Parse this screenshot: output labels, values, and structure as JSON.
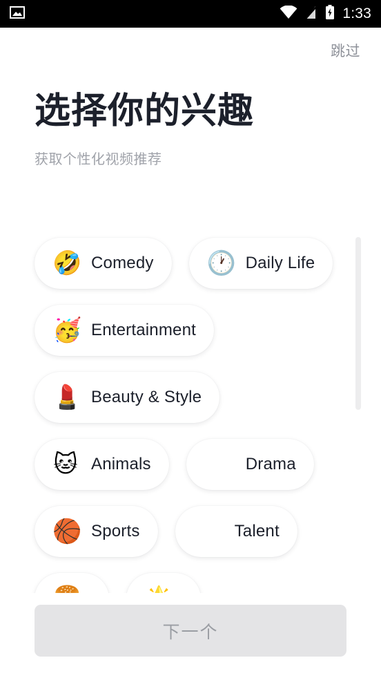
{
  "status_bar": {
    "time": "1:33",
    "icons": {
      "left": "image-icon",
      "wifi": "wifi-icon",
      "signal": "signal-off-icon",
      "battery": "battery-charging-icon"
    },
    "background_color": "#000000",
    "foreground_color": "#ffffff"
  },
  "header": {
    "skip_label": "跳过",
    "title": "选择你的兴趣",
    "subtitle": "获取个性化视频推荐",
    "title_color": "#1c202b",
    "subtitle_color": "#a0a3aa"
  },
  "interests": {
    "chips": [
      {
        "label": "Comedy",
        "emoji": "🤣",
        "icon_name": "rolling-on-floor-laughing-emoji"
      },
      {
        "label": "Daily Life",
        "emoji": "🕐",
        "icon_name": "clock-emoji"
      },
      {
        "label": "Entertainment",
        "emoji": "🥳",
        "icon_name": "partying-face-emoji"
      },
      {
        "label": "Beauty & Style",
        "emoji": "💄",
        "icon_name": "lipstick-emoji"
      },
      {
        "label": "Animals",
        "emoji": "🐱",
        "icon_name": "cat-face-emoji"
      },
      {
        "label": "Drama",
        "emoji": "",
        "icon_name": "missing-emoji"
      },
      {
        "label": "Sports",
        "emoji": "🏀",
        "icon_name": "basketball-emoji"
      },
      {
        "label": "Talent",
        "emoji": "",
        "icon_name": "missing-emoji"
      },
      {
        "label": "",
        "emoji": "🍔",
        "icon_name": "food-emoji"
      },
      {
        "label": "",
        "emoji": "🌟",
        "icon_name": "star-emoji"
      }
    ],
    "chip_background": "#ffffff",
    "chip_text_color": "#1c202b",
    "scrollbar_color": "#ededee"
  },
  "cta": {
    "next_label": "下一个",
    "enabled": false,
    "background_color": "#e4e4e6",
    "text_color": "#9a9da3"
  }
}
